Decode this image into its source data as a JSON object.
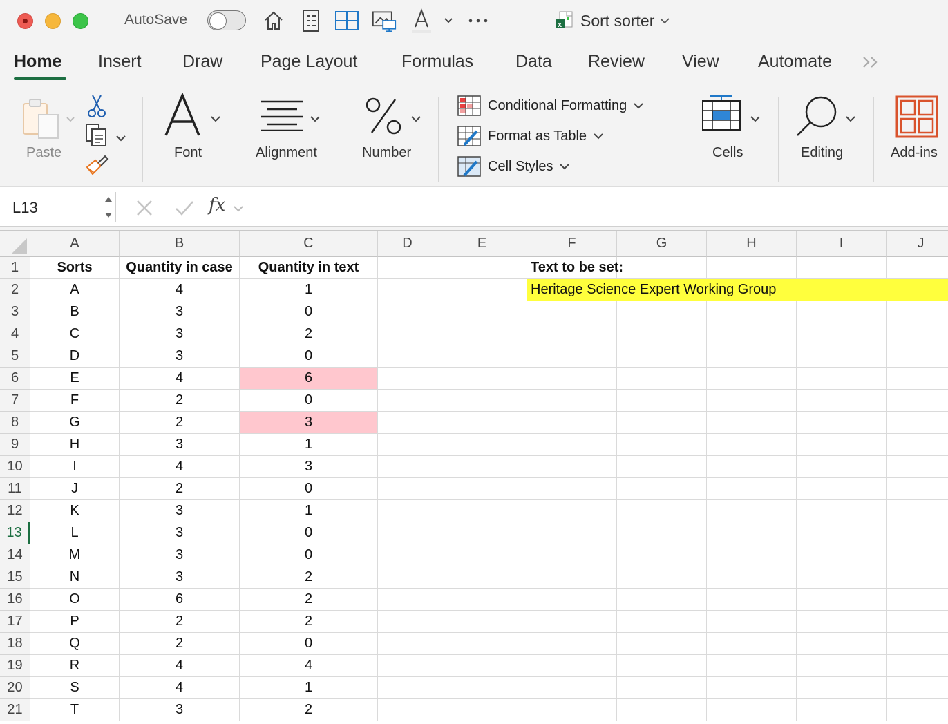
{
  "titlebar": {
    "autosave_label": "AutoSave",
    "document_title": "Sort sorter"
  },
  "tabs": [
    "Home",
    "Insert",
    "Draw",
    "Page Layout",
    "Formulas",
    "Data",
    "Review",
    "View",
    "Automate"
  ],
  "ribbon": {
    "paste_label": "Paste",
    "font_label": "Font",
    "alignment_label": "Alignment",
    "number_label": "Number",
    "conditional_formatting": "Conditional Formatting",
    "format_as_table": "Format as Table",
    "cell_styles": "Cell Styles",
    "cells_label": "Cells",
    "editing_label": "Editing",
    "addins_label": "Add-ins"
  },
  "formula_bar": {
    "name_box": "L13",
    "fx_label": "fx",
    "content": ""
  },
  "sheet": {
    "columns": [
      "A",
      "B",
      "C",
      "D",
      "E",
      "F",
      "G",
      "H",
      "I",
      "J"
    ],
    "selected_row": 13,
    "header_row": {
      "A": "Sorts",
      "B": "Quantity in case",
      "C": "Quantity in text",
      "F": "Text to be set:"
    },
    "F2": "Heritage Science Expert Working Group",
    "rows": [
      {
        "row": 2,
        "A": "A",
        "B": "4",
        "C": "1"
      },
      {
        "row": 3,
        "A": "B",
        "B": "3",
        "C": "0"
      },
      {
        "row": 4,
        "A": "C",
        "B": "3",
        "C": "2"
      },
      {
        "row": 5,
        "A": "D",
        "B": "3",
        "C": "0"
      },
      {
        "row": 6,
        "A": "E",
        "B": "4",
        "C": "6"
      },
      {
        "row": 7,
        "A": "F",
        "B": "2",
        "C": "0"
      },
      {
        "row": 8,
        "A": "G",
        "B": "2",
        "C": "3"
      },
      {
        "row": 9,
        "A": "H",
        "B": "3",
        "C": "1"
      },
      {
        "row": 10,
        "A": "I",
        "B": "4",
        "C": "3"
      },
      {
        "row": 11,
        "A": "J",
        "B": "2",
        "C": "0"
      },
      {
        "row": 12,
        "A": "K",
        "B": "3",
        "C": "1"
      },
      {
        "row": 13,
        "A": "L",
        "B": "3",
        "C": "0"
      },
      {
        "row": 14,
        "A": "M",
        "B": "3",
        "C": "0"
      },
      {
        "row": 15,
        "A": "N",
        "B": "3",
        "C": "2"
      },
      {
        "row": 16,
        "A": "O",
        "B": "6",
        "C": "2"
      },
      {
        "row": 17,
        "A": "P",
        "B": "2",
        "C": "2"
      },
      {
        "row": 18,
        "A": "Q",
        "B": "2",
        "C": "0"
      },
      {
        "row": 19,
        "A": "R",
        "B": "4",
        "C": "4"
      },
      {
        "row": 20,
        "A": "S",
        "B": "4",
        "C": "1"
      },
      {
        "row": 21,
        "A": "T",
        "B": "3",
        "C": "2"
      }
    ],
    "highlight_colors": {
      "pink": "#ffc7ce",
      "yellow": "#ffff3d"
    },
    "pink_cells": [
      "C6",
      "C8"
    ]
  },
  "accent_color": "#1d6f42"
}
